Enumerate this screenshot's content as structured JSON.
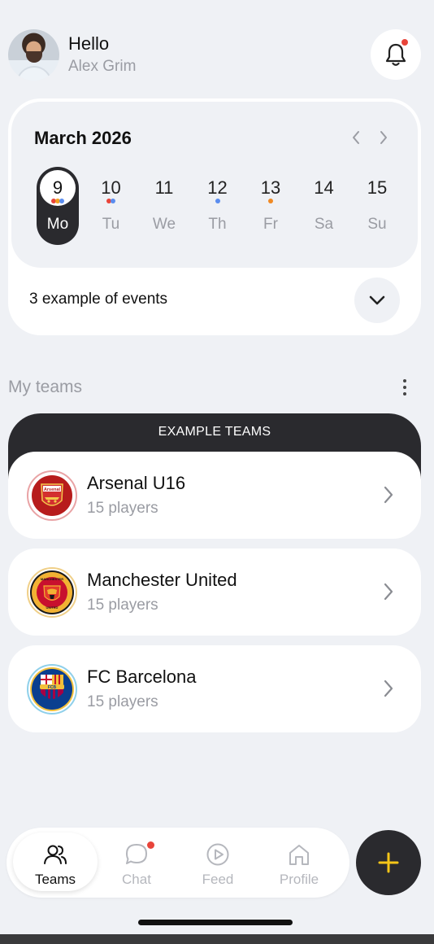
{
  "header": {
    "greeting": "Hello",
    "user_name": "Alex Grim",
    "notification_badge": true
  },
  "calendar": {
    "month_label": "March 2026",
    "days": [
      {
        "num": "9",
        "label": "Mo",
        "selected": true,
        "dots": [
          "#e8443a",
          "#f0a020",
          "#5b8def"
        ]
      },
      {
        "num": "10",
        "label": "Tu",
        "selected": false,
        "dots": [
          "#e8443a",
          "#5b8def"
        ]
      },
      {
        "num": "11",
        "label": "We",
        "selected": false,
        "dots": []
      },
      {
        "num": "12",
        "label": "Th",
        "selected": false,
        "dots": [
          "#5b8def"
        ]
      },
      {
        "num": "13",
        "label": "Fr",
        "selected": false,
        "dots": [
          "#f08a24"
        ]
      },
      {
        "num": "14",
        "label": "Sa",
        "selected": false,
        "dots": []
      },
      {
        "num": "15",
        "label": "Su",
        "selected": false,
        "dots": []
      }
    ],
    "events_summary": "3 example of events"
  },
  "teams": {
    "title": "My teams",
    "group_label": "EXAMPLE TEAMS",
    "items": [
      {
        "name": "Arsenal U16",
        "players": "15 players",
        "crest": "arsenal-crest-icon"
      },
      {
        "name": "Manchester United",
        "players": "15 players",
        "crest": "man-utd-crest-icon"
      },
      {
        "name": "FC Barcelona",
        "players": "15 players",
        "crest": "barcelona-crest-icon"
      }
    ]
  },
  "nav": {
    "items": [
      {
        "label": "Teams",
        "icon": "users-icon",
        "active": true
      },
      {
        "label": "Chat",
        "icon": "chat-icon",
        "active": false,
        "badge": true
      },
      {
        "label": "Feed",
        "icon": "play-icon",
        "active": false
      },
      {
        "label": "Profile",
        "icon": "home-icon",
        "active": false
      }
    ]
  },
  "colors": {
    "background": "#eff1f5",
    "dark": "#2a2a2e",
    "accent": "#f5c518",
    "badge": "#e8443a",
    "muted_text": "#9a9ca3"
  }
}
